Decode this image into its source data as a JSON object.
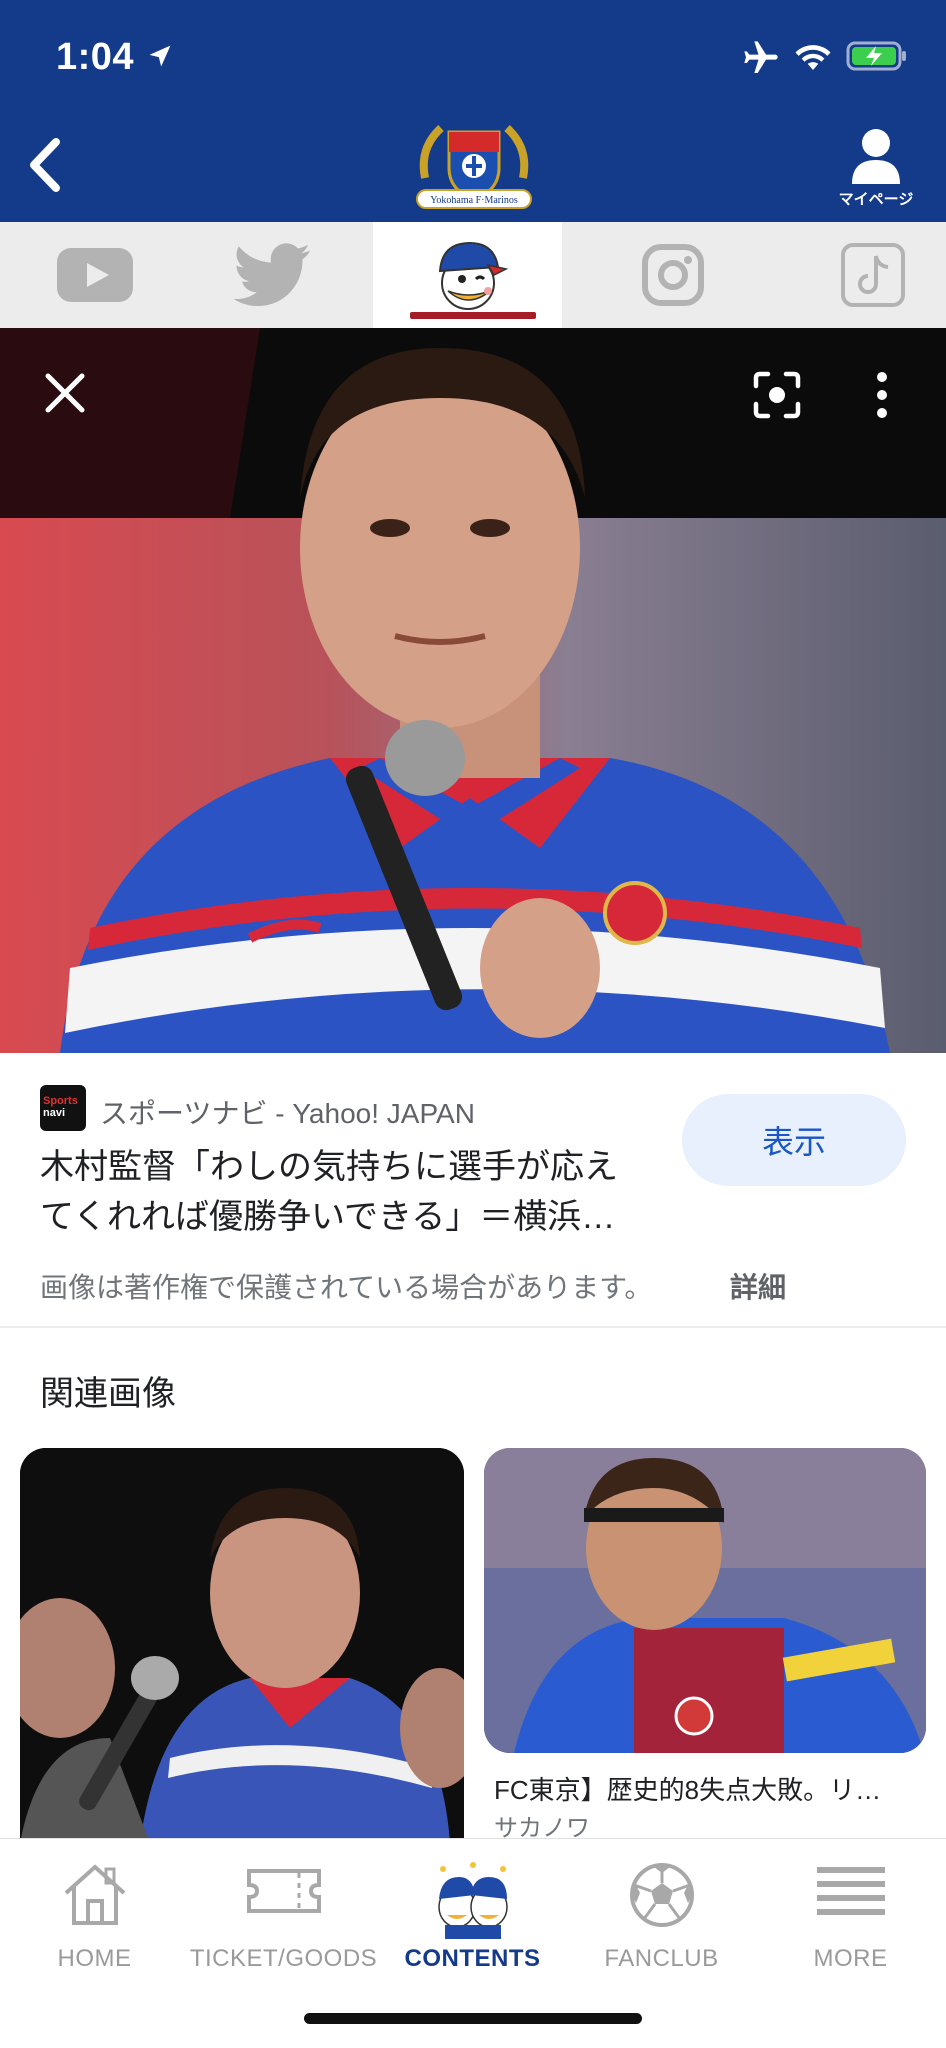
{
  "status_bar": {
    "time": "1:04"
  },
  "header": {
    "mypage_label": "マイページ",
    "logo_text": "Yokohama F·Marinos"
  },
  "social_tabs": [
    {
      "name": "youtube",
      "active": false
    },
    {
      "name": "twitter",
      "active": false
    },
    {
      "name": "mascot",
      "active": true
    },
    {
      "name": "instagram",
      "active": false
    },
    {
      "name": "tiktok",
      "active": false
    }
  ],
  "result": {
    "source_logo_top": "Sports",
    "source_logo_bottom": "navi",
    "source_name": "スポーツナビ - Yahoo! JAPAN",
    "title_line1": "木村監督「わしの気持ちに選手が応え",
    "title_line2": "てくれれば優勝争いできる」＝横浜…",
    "view_button": "表示",
    "copyright_note": "画像は著作権で保護されている場合があります。",
    "details_link": "詳細"
  },
  "related": {
    "heading": "関連画像",
    "items": [
      {
        "caption": "",
        "source": ""
      },
      {
        "caption": "FC東京】歴史的8失点大敗。リ…",
        "source": "サカノワ"
      }
    ]
  },
  "bottom_nav": {
    "items": [
      {
        "label": "HOME",
        "active": false
      },
      {
        "label": "TICKET/GOODS",
        "active": false
      },
      {
        "label": "CONTENTS",
        "active": true
      },
      {
        "label": "FANCLUB",
        "active": false
      },
      {
        "label": "MORE",
        "active": false
      }
    ]
  },
  "colors": {
    "brand_blue": "#143a8a",
    "accent_red": "#a71d27",
    "button_blue": "#1a56c4"
  }
}
